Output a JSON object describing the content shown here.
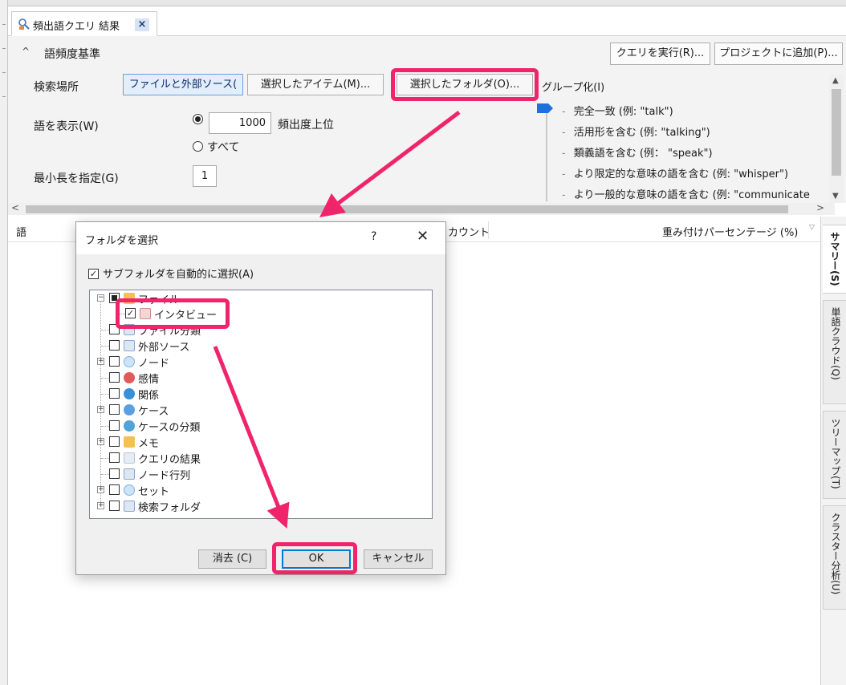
{
  "tab": {
    "title": "頻出語クエリ 結果",
    "close": "×"
  },
  "criteria": {
    "collapse": "^",
    "title": "語頻度基準",
    "run_query": "クエリを実行(R)...",
    "add_to_project": "プロジェクトに追加(P)...",
    "search_in_label": "検索場所",
    "scope_files": "ファイルと外部ソース(",
    "scope_items": "選択したアイテム(M)...",
    "scope_folders": "選択したフォルダ(O)...",
    "show_words_label": "語を表示(W)",
    "top_count": "1000",
    "top_suffix": "頻出度上位",
    "all_label": "すべて",
    "min_length_label": "最小長を指定(G)",
    "min_length_value": "1",
    "grouping_label": "グループ化(I)",
    "grouping_options": [
      "完全一致 (例: \"talk\")",
      "活用形を含む (例: \"talking\")",
      "類義語を含む (例： \"speak\")",
      "より限定的な意味の語を含む (例: \"whisper\")",
      "より一般的な意味の語を含む (例: \"communicate"
    ]
  },
  "results": {
    "col_word": "語",
    "col_count": "カウント",
    "col_weighted": "重み付けパーセンテージ (%)",
    "sort_glyph": "▽"
  },
  "right_tabs": [
    "サマリー(S)",
    "単語クラウド(Q)",
    "ツリーマップ(T)",
    "クラスター分析(U)"
  ],
  "dialog": {
    "title": "フォルダを選択",
    "help": "?",
    "close": "✕",
    "auto_select_label": "サブフォルダを自動的に選択(A)",
    "tree": [
      {
        "label": "ファイル",
        "level": 0,
        "expander": "⊟",
        "check": "partial",
        "icon_color": "#f2c14e"
      },
      {
        "label": "インタビュー",
        "level": 1,
        "expander": "",
        "check": "checked",
        "icon_color": "#e08a8a"
      },
      {
        "label": "ファイル分類",
        "level": 1,
        "expander": "",
        "check": "empty",
        "icon_color": "#9db7d9"
      },
      {
        "label": "外部ソース",
        "level": 0,
        "expander": "",
        "check": "empty",
        "icon_color": "#9db7d9"
      },
      {
        "label": "ノード",
        "level": 0,
        "expander": "⊞",
        "check": "empty",
        "icon_color": "#7fb0e6"
      },
      {
        "label": "感情",
        "level": 0,
        "expander": "",
        "check": "empty",
        "icon_color": "#e25b5b"
      },
      {
        "label": "関係",
        "level": 0,
        "expander": "",
        "check": "empty",
        "icon_color": "#3a8fd9"
      },
      {
        "label": "ケース",
        "level": 0,
        "expander": "⊞",
        "check": "empty",
        "icon_color": "#5aa0e0"
      },
      {
        "label": "ケースの分類",
        "level": 0,
        "expander": "",
        "check": "empty",
        "icon_color": "#4fa3d6"
      },
      {
        "label": "メモ",
        "level": 0,
        "expander": "⊞",
        "check": "empty",
        "icon_color": "#f2c14e"
      },
      {
        "label": "クエリの結果",
        "level": 0,
        "expander": "",
        "check": "empty",
        "icon_color": "#b8c6d8"
      },
      {
        "label": "ノード行列",
        "level": 0,
        "expander": "",
        "check": "empty",
        "icon_color": "#9db7d9"
      },
      {
        "label": "セット",
        "level": 0,
        "expander": "⊞",
        "check": "empty",
        "icon_color": "#7fb0e6"
      },
      {
        "label": "検索フォルダ",
        "level": 0,
        "expander": "⊞",
        "check": "empty",
        "icon_color": "#9db7d9"
      }
    ],
    "clear_btn": "消去 (C)",
    "ok_btn": "OK",
    "cancel_btn": "キャンセル"
  },
  "colors": {
    "highlight": "#f0246a",
    "accent": "#1e70e0"
  }
}
